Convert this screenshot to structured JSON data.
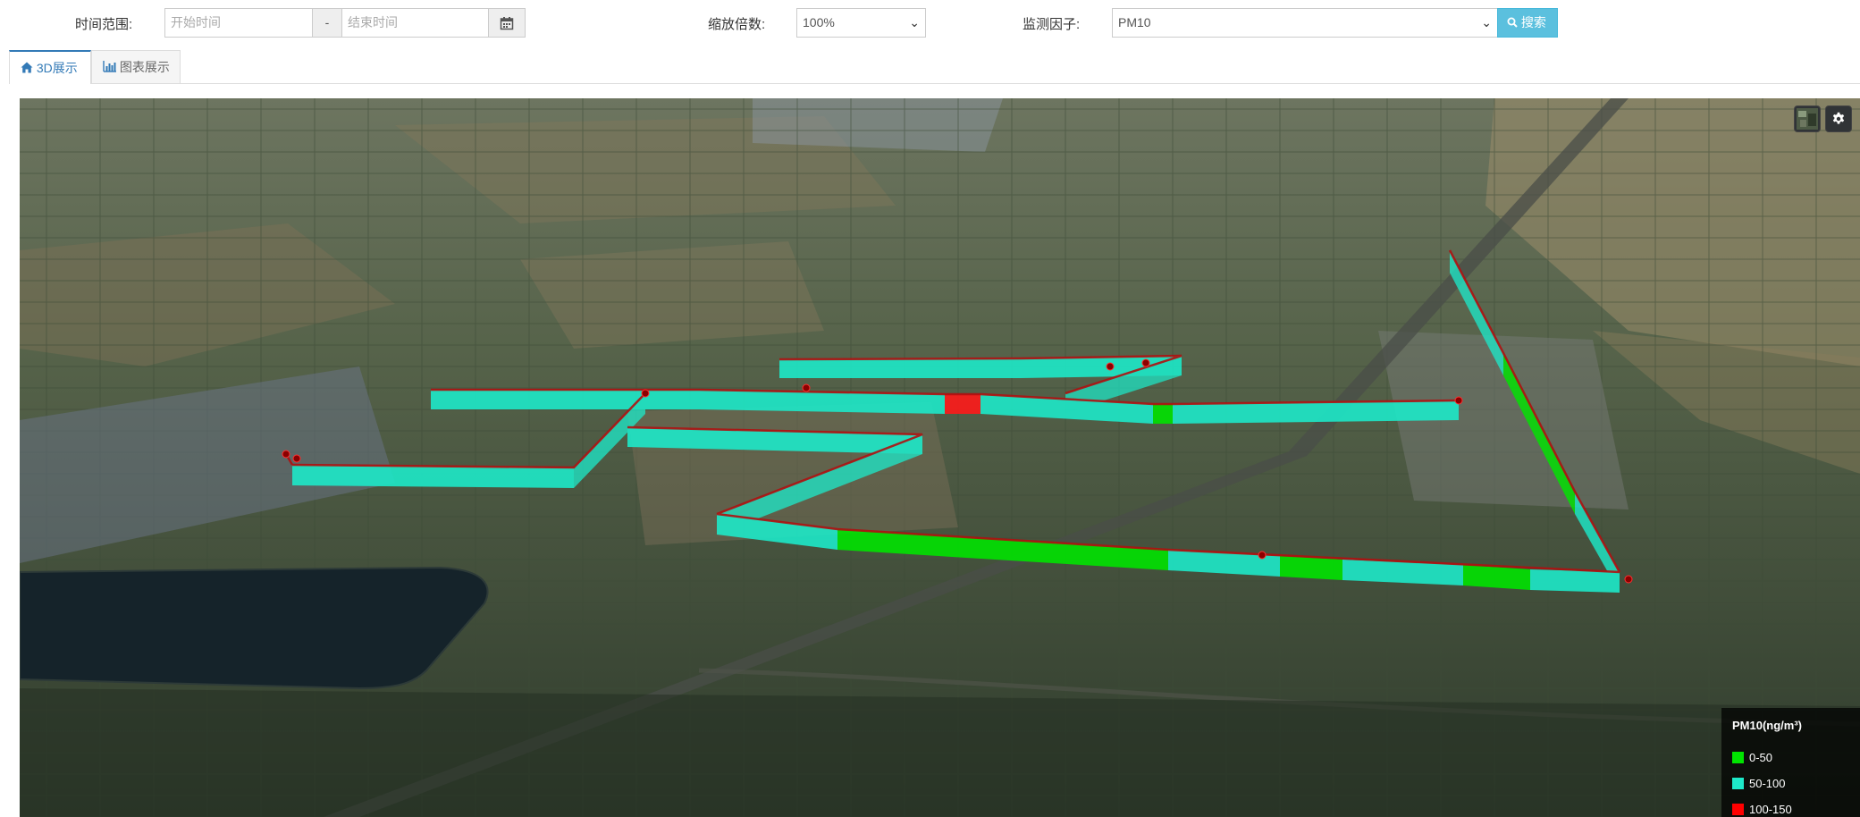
{
  "toolbar": {
    "time_range_label": "时间范围:",
    "start_placeholder": "开始时间",
    "separator": "-",
    "end_placeholder": "结束时间",
    "zoom_label": "缩放倍数:",
    "zoom_value": "100%",
    "factor_label": "监测因子:",
    "factor_value": "PM10",
    "search_label": "搜索"
  },
  "tabs": [
    {
      "label": "3D展示",
      "icon": "home-icon",
      "active": true
    },
    {
      "label": "图表展示",
      "icon": "bar-chart-icon",
      "active": false
    }
  ],
  "map": {
    "controls": [
      {
        "name": "base-layer-picker",
        "icon": "imagery-thumbnail-icon"
      },
      {
        "name": "settings",
        "icon": "gear-icon"
      }
    ],
    "legend": {
      "title": "PM10(ng/m³)",
      "items": [
        {
          "label": "0-50",
          "color": "#00e400"
        },
        {
          "label": "50-100",
          "color": "#1de9c9"
        },
        {
          "label": "100-150",
          "color": "#ff0000"
        }
      ]
    }
  },
  "colors": {
    "accent": "#337ab7",
    "search_button": "#5bc0de",
    "wall_cyan": "#1de9c9",
    "wall_green": "#00e400",
    "wall_red": "#ff0000"
  }
}
